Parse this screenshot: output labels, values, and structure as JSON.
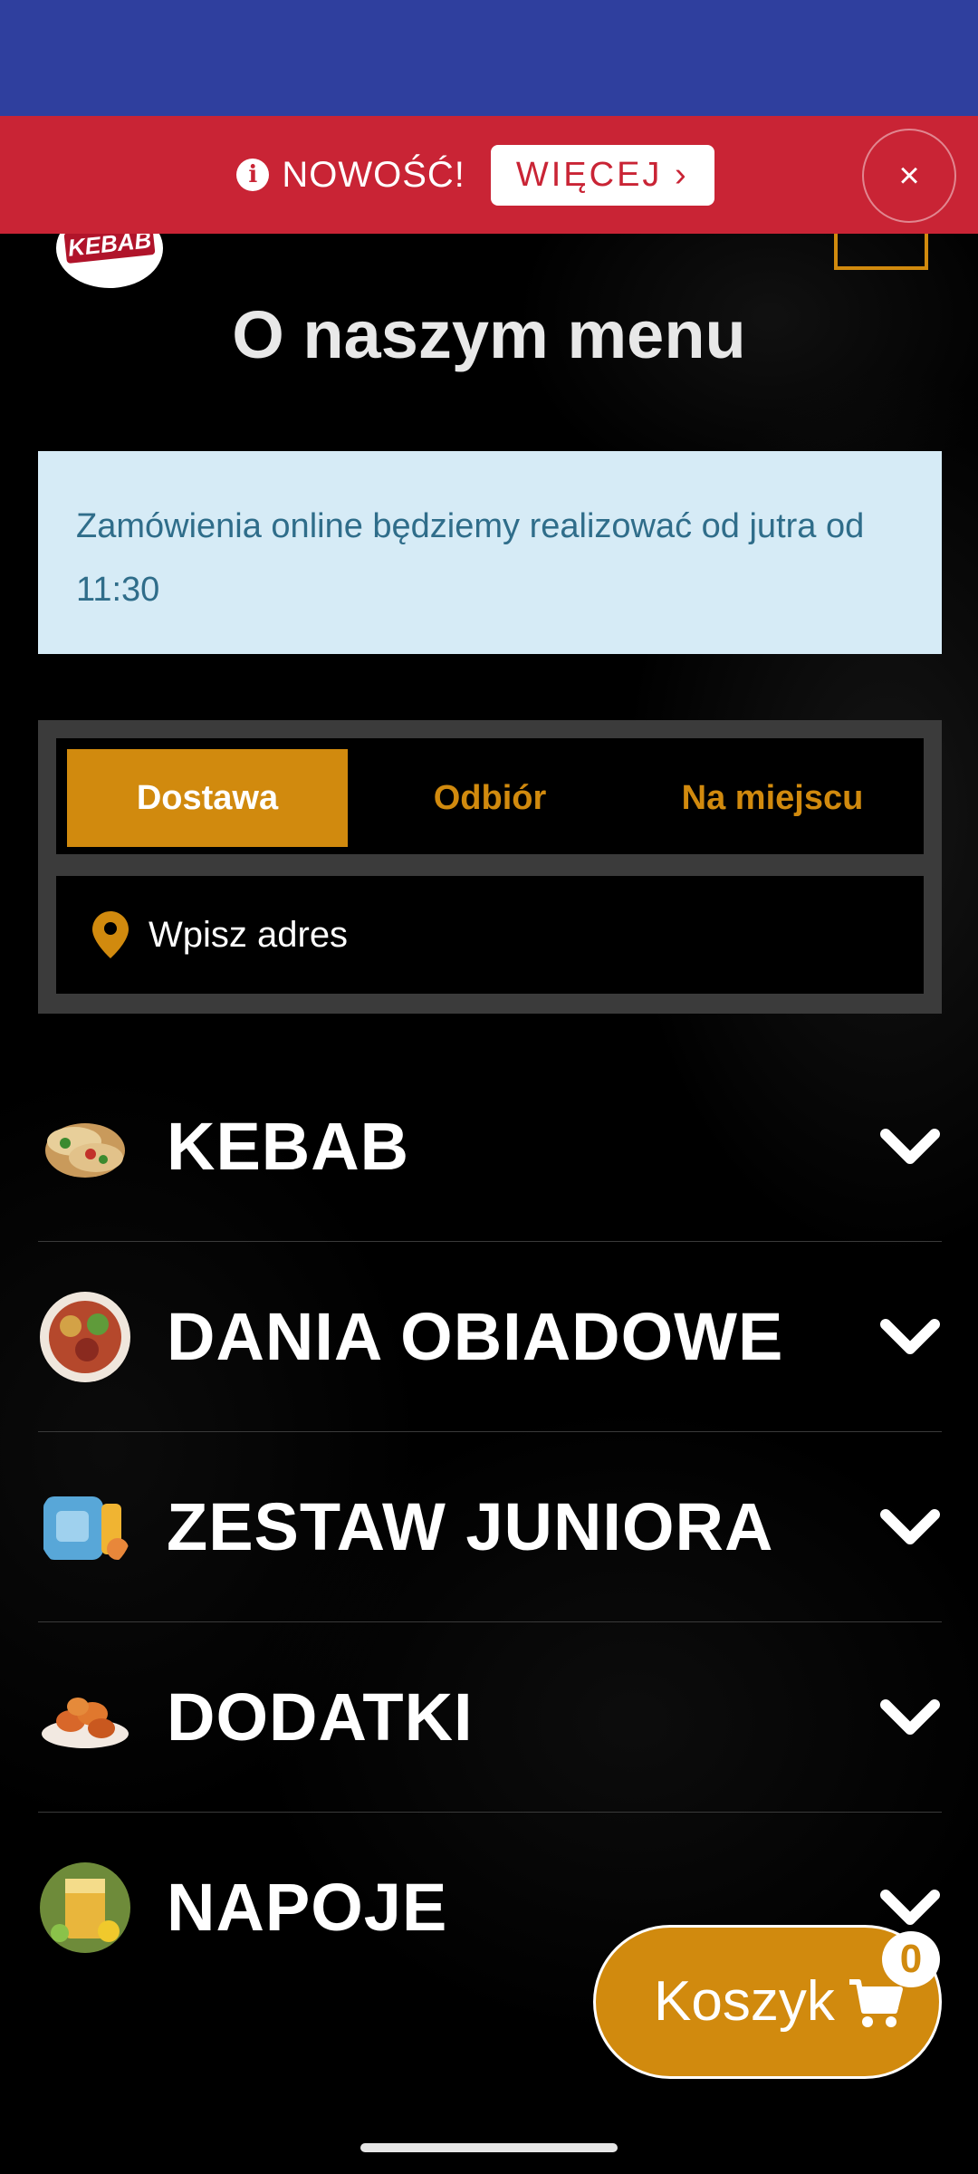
{
  "promo": {
    "label": "NOWOŚĆ!",
    "button_label": "WIĘCEJ ›",
    "close_label": "×",
    "info_icon": "info-icon",
    "color": "#c92435"
  },
  "header": {
    "logo_text": "KEBAB",
    "menu_icon": "hamburger-icon"
  },
  "page": {
    "title": "O naszym menu"
  },
  "notice": {
    "text": "Zamówienia online będziemy realizować od jutra od 11:30"
  },
  "order": {
    "tabs": [
      {
        "label": "Dostawa",
        "active": true
      },
      {
        "label": "Odbiór",
        "active": false
      },
      {
        "label": "Na miejscu",
        "active": false
      }
    ],
    "address_placeholder": "Wpisz adres",
    "address_icon": "map-pin-icon",
    "accent": "#d18a0e"
  },
  "categories": [
    {
      "label": "KEBAB",
      "icon": "kebab-icon"
    },
    {
      "label": "DANIA OBIADOWE",
      "icon": "dinner-plate-icon"
    },
    {
      "label": "ZESTAW JUNIORA",
      "icon": "kids-set-icon"
    },
    {
      "label": "DODATKI",
      "icon": "nuggets-icon"
    },
    {
      "label": "NAPOJE",
      "icon": "drink-icon"
    }
  ],
  "cart": {
    "label": "Koszyk",
    "count": "0",
    "icon": "cart-icon"
  }
}
